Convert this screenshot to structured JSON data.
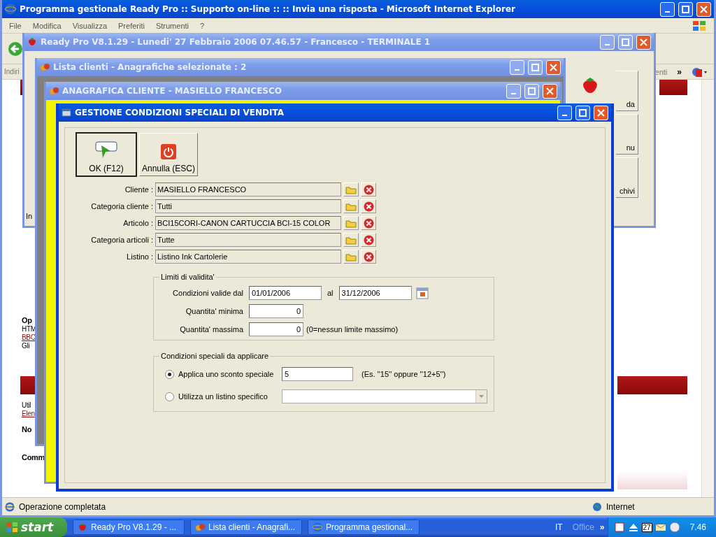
{
  "browser": {
    "title": "Programma gestionale Ready Pro :: Supporto on-line :: :: Invia una risposta - Microsoft Internet Explorer",
    "menu": [
      "File",
      "Modifica",
      "Visualizza",
      "Preferiti",
      "Strumenti",
      "?"
    ],
    "address_label": "Indiri",
    "links_label": "enti",
    "chevron": "»",
    "page_fragments": [
      {
        "text": "Op",
        "kind": "heading"
      },
      {
        "text": "HTM",
        "kind": "text"
      },
      {
        "text": "BBC",
        "kind": "link"
      },
      {
        "text": "Gli",
        "kind": "text"
      },
      {
        "text": "Util",
        "kind": "text"
      },
      {
        "text": "Elen",
        "kind": "link"
      },
      {
        "text": "No",
        "kind": "heading"
      },
      {
        "text": "Comm",
        "kind": "heading"
      }
    ],
    "status": "Operazione completata",
    "zone": "Internet"
  },
  "readypro": {
    "title": "Ready Pro V8.1.29 - Lunedi' 27 Febbraio 2006  07.46.57 - Francesco - TERMINALE 1",
    "side_buttons": [
      "da",
      "nu",
      "chivi"
    ],
    "status_fragment": "In"
  },
  "lista": {
    "title": "Lista clienti - Anagrafiche selezionate : 2"
  },
  "anagrafica": {
    "title": "ANAGRAFICA CLIENTE - MASIELLO FRANCESCO"
  },
  "dialog": {
    "title": "GESTIONE CONDIZIONI SPECIALI DI VENDITA",
    "buttons": [
      {
        "label": "OK (F12)",
        "kind": "ok"
      },
      {
        "label": "Annulla (ESC)",
        "kind": "cancel"
      }
    ],
    "fields": [
      {
        "label": "Cliente :",
        "value": "MASIELLO FRANCESCO"
      },
      {
        "label": "Categoria cliente :",
        "value": "Tutti"
      },
      {
        "label": "Articolo :",
        "value": "BCI15CORI-CANON CARTUCCIA BCI-15 COLOR"
      },
      {
        "label": "Categoria articoli :",
        "value": "Tutte"
      },
      {
        "label": "Listino :",
        "value": "Listino Ink Cartolerie"
      }
    ],
    "validity": {
      "legend": "Limiti di validita'",
      "from_label": "Condizioni valide dal",
      "from": "01/01/2006",
      "to_label": "al",
      "to": "31/12/2006",
      "min_label": "Quantita' minima",
      "min": "0",
      "max_label": "Quantita' massima",
      "max": "0",
      "max_hint": "(0=nessun limite massimo)"
    },
    "special": {
      "legend": "Condizioni speciali da applicare",
      "options": [
        {
          "label": "Applica uno sconto speciale",
          "selected": true,
          "kind": "text",
          "value": "5",
          "hint": "(Es. ''15'' oppure ''12+5'')"
        },
        {
          "label": "Utilizza un listino specifico",
          "selected": false,
          "kind": "select"
        }
      ]
    }
  },
  "taskbar": {
    "start": "start",
    "tasks": [
      "Ready Pro V8.1.29 - ...",
      "Lista clienti - Anagrafi...",
      "Programma gestional..."
    ],
    "language": "IT",
    "toolbar": "Office",
    "chevron": "»",
    "calendar_day": "27",
    "clock": "7.46"
  }
}
